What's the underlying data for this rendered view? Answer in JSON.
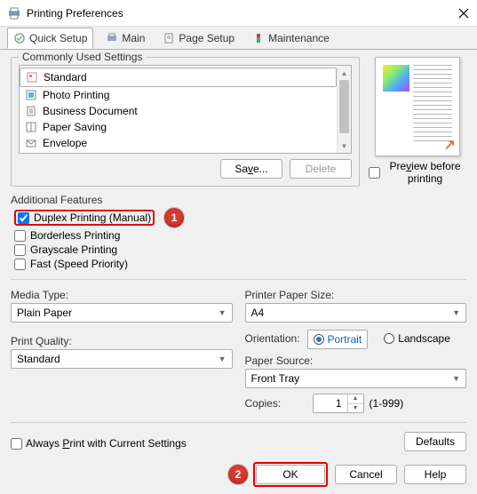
{
  "title": "Printing Preferences",
  "tabs": {
    "quick": "Quick Setup",
    "main": "Main",
    "page": "Page Setup",
    "maint": "Maintenance"
  },
  "commonly_used": {
    "title": "Commonly Used Settings",
    "items": [
      "Standard",
      "Photo Printing",
      "Business Document",
      "Paper Saving",
      "Envelope"
    ],
    "save": "Save...",
    "delete": "Delete"
  },
  "preview": {
    "checkbox": "Preview before printing"
  },
  "features": {
    "title": "Additional Features",
    "duplex": "Duplex Printing (Manual)",
    "borderless": "Borderless Printing",
    "grayscale": "Grayscale Printing",
    "fast": "Fast (Speed Priority)"
  },
  "media": {
    "label": "Media Type:",
    "value": "Plain Paper"
  },
  "quality": {
    "label": "Print Quality:",
    "value": "Standard"
  },
  "paper_size": {
    "label": "Printer Paper Size:",
    "value": "A4"
  },
  "orientation": {
    "label": "Orientation:",
    "portrait": "Portrait",
    "landscape": "Landscape"
  },
  "source": {
    "label": "Paper Source:",
    "value": "Front Tray"
  },
  "copies": {
    "label": "Copies:",
    "value": "1",
    "range": "(1-999)"
  },
  "always": "Always Print with Current Settings",
  "defaults": "Defaults",
  "buttons": {
    "ok": "OK",
    "cancel": "Cancel",
    "help": "Help"
  },
  "markers": {
    "one": "1",
    "two": "2"
  }
}
